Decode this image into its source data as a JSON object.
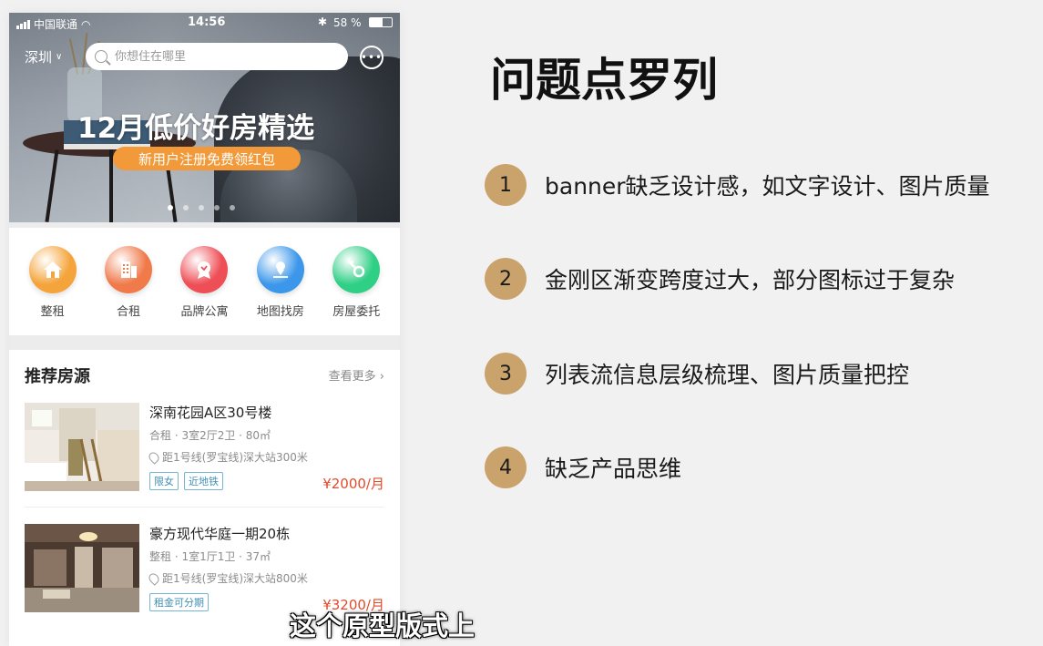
{
  "status_bar": {
    "carrier": "中国联通",
    "time": "14:56",
    "battery": "58 %"
  },
  "header": {
    "city": "深圳",
    "search_placeholder": "你想住在哪里"
  },
  "banner": {
    "title": "12月低价好房精选",
    "cta": "新用户注册免费领红包",
    "dots": 5,
    "active_dot": 0
  },
  "categories": [
    {
      "label": "整租",
      "icon": "house-icon",
      "color": "#f4a43a"
    },
    {
      "label": "合租",
      "icon": "building-icon",
      "color": "#f07a4a"
    },
    {
      "label": "品牌公寓",
      "icon": "badge-icon",
      "color": "#ee4f57"
    },
    {
      "label": "地图找房",
      "icon": "map-pin-icon",
      "color": "#3c97ea"
    },
    {
      "label": "房屋委托",
      "icon": "key-icon",
      "color": "#2fcf86"
    }
  ],
  "listings": {
    "title": "推荐房源",
    "more": "查看更多 ›",
    "items": [
      {
        "name": "深南花园A区30号楼",
        "meta": "合租 · 3室2厅2卫 · 80㎡",
        "location": "距1号线(罗宝线)深大站300米",
        "tags": [
          "限女",
          "近地铁"
        ],
        "price": "¥2000/月"
      },
      {
        "name": "豪方现代华庭一期20栋",
        "meta": "整租 · 1室1厅1卫 · 37㎡",
        "location": "距1号线(罗宝线)深大站800米",
        "tags": [
          "租金可分期"
        ],
        "price": "¥3200/月"
      }
    ]
  },
  "slide": {
    "title": "问题点罗列",
    "points": [
      {
        "num": "1",
        "text": "banner缺乏设计感，如文字设计、图片质量"
      },
      {
        "num": "2",
        "text": "金刚区渐变跨度过大，部分图标过于复杂"
      },
      {
        "num": "3",
        "text": "列表流信息层级梳理、图片质量把控"
      },
      {
        "num": "4",
        "text": "缺乏产品思维"
      }
    ]
  },
  "subtitle": "这个原型版式上"
}
